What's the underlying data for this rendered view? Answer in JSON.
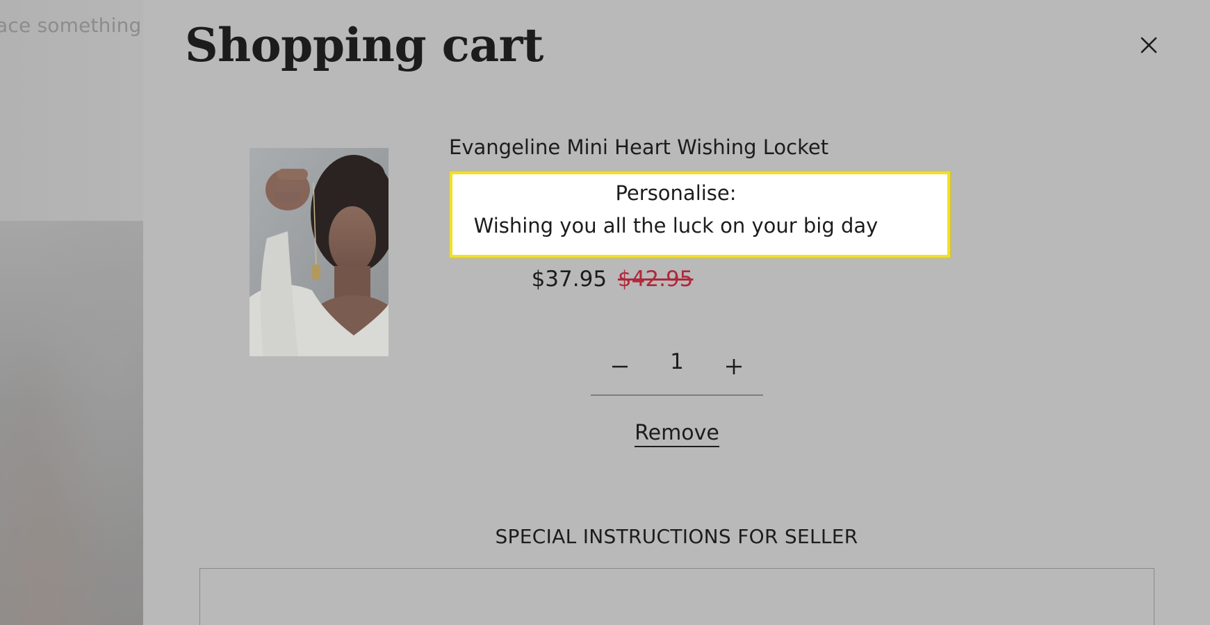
{
  "background": {
    "teaser_text": "ace something h"
  },
  "cart": {
    "title": "Shopping cart",
    "close_label": "close-icon",
    "item": {
      "title": "Evangeline Mini Heart Wishing Locket",
      "personalise": {
        "label": "Personalise:",
        "value": "Wishing you all the luck on your big day"
      },
      "price": "$37.95",
      "compare_price": "$42.95",
      "quantity": "1",
      "remove_label": "Remove"
    },
    "instructions": {
      "label": "SPECIAL INSTRUCTIONS FOR SELLER",
      "value": ""
    }
  },
  "colors": {
    "overlay_background": "#b9b9b9",
    "compare_price": "#b0283a",
    "highlight_border": "#f2df2a"
  },
  "icons": [
    "close-icon",
    "minus-icon",
    "plus-icon"
  ]
}
